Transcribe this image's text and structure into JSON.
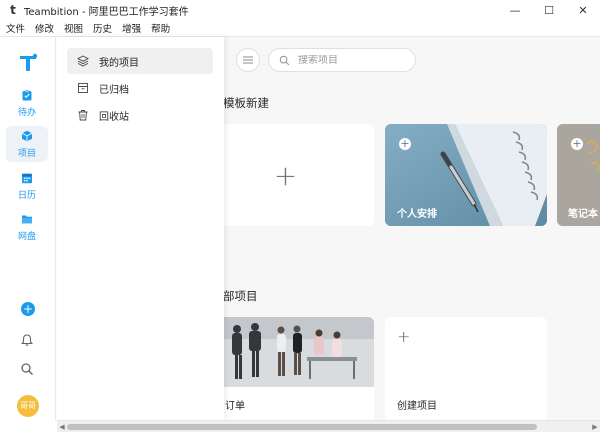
{
  "window": {
    "title": "Teambition - 阿里巴巴工作学习套件",
    "app_icon": "t",
    "minimize": "—",
    "maximize": "☐",
    "close": "✕"
  },
  "menu": [
    "文件",
    "修改",
    "视图",
    "历史",
    "增强",
    "帮助"
  ],
  "rail": {
    "items": [
      {
        "label": "待办",
        "icon": "clipboard-icon"
      },
      {
        "label": "项目",
        "icon": "cube-icon"
      },
      {
        "label": "日历",
        "icon": "calendar-icon"
      },
      {
        "label": "网盘",
        "icon": "folder-icon"
      }
    ],
    "add": "+",
    "avatar": "哥哥"
  },
  "panel": {
    "items": [
      {
        "label": "我的项目",
        "icon": "layers-icon"
      },
      {
        "label": "已归档",
        "icon": "archive-icon"
      },
      {
        "label": "回收站",
        "icon": "trash-icon"
      }
    ]
  },
  "search": {
    "placeholder": "搜索项目"
  },
  "templates": {
    "title": "模板新建",
    "add_symbol": "+",
    "cards": [
      {
        "label": "个人安排"
      },
      {
        "label": "笔记本"
      }
    ]
  },
  "projects": {
    "title": "部项目",
    "cards": [
      {
        "label": "订单"
      },
      {
        "label": "创建项目"
      }
    ]
  },
  "colors": {
    "accent": "#1b9aee",
    "avatar": "#f5bd3b",
    "template_blue": "#6f9bb3"
  }
}
